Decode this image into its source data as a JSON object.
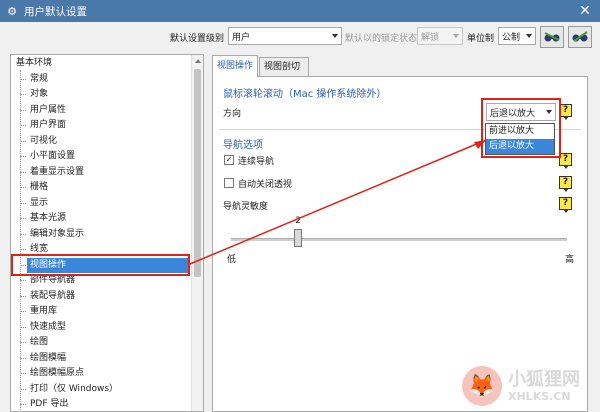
{
  "window": {
    "title": "用户默认设置",
    "close_glyph": "✕"
  },
  "toolbar": {
    "level_label": "默认设置级别",
    "level_value": "用户",
    "locked_label": "默认以的锁定状态",
    "locked_value": "解锁",
    "unit_label": "单位制",
    "unit_value": "公制"
  },
  "tree": {
    "root": "基本环境",
    "items": [
      "常规",
      "对象",
      "用户属性",
      "用户界面",
      "可视化",
      "小平面设置",
      "着重显示设置",
      "栅格",
      "显示",
      "基本光源",
      "编辑对象显示",
      "线宽",
      "视图操作",
      "部件导航器",
      "装配导航器",
      "重用库",
      "快速成型",
      "绘图",
      "绘图模幅",
      "绘图模幅原点",
      "打印（仅 Windows）",
      "PDF 导出"
    ],
    "selected": "视图操作"
  },
  "tabs": [
    "视图操作",
    "视图剖切"
  ],
  "active_tab": "视图操作",
  "panel": {
    "mouse_section": "鼠标滚轮滚动（Mac 操作系统除外）",
    "direction_label": "方向",
    "direction_value": "后退以放大",
    "direction_options": [
      "前进以放大",
      "后退以放大"
    ],
    "nav_section": "导航选项",
    "continuous_nav_label": "连续导航",
    "continuous_nav_checked": true,
    "auto_close_label": "自动关闭透视",
    "auto_close_checked": false,
    "sensitivity_label": "导航灵敏度",
    "sensitivity_value": "2",
    "sensitivity_level": 0.2,
    "low_label": "低",
    "high_label": "高",
    "help_glyph": "?"
  },
  "watermark": {
    "main": "小狐狸网",
    "sub": "XHLKS.CN"
  },
  "colors": {
    "title_bar": "#4a78a8",
    "selection": "#3a86d8",
    "section_title": "#2a60b0",
    "highlight": "#e0231a",
    "help": "#ffe84a"
  }
}
